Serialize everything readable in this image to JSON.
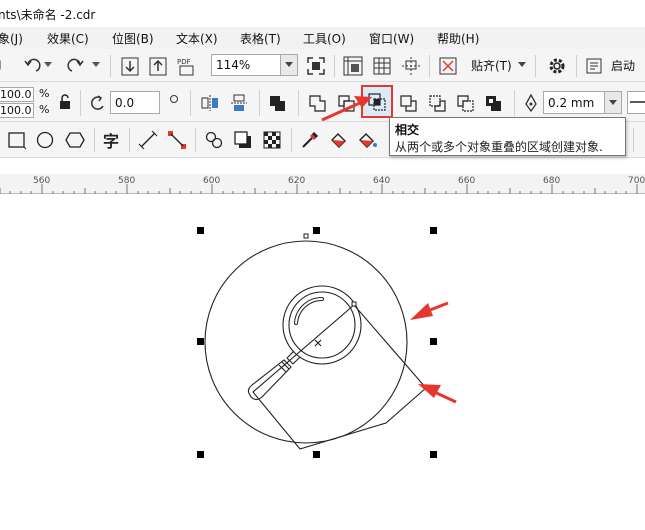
{
  "window": {
    "title": "nts\\未命名 -2.cdr"
  },
  "menubar": {
    "items": [
      "象(J)",
      "效果(C)",
      "位图(B)",
      "文本(X)",
      "表格(T)",
      "工具(O)",
      "窗口(W)",
      "帮助(H)"
    ]
  },
  "standard_toolbar": {
    "zoom_value": "114%",
    "snap_label": "贴齐(T)",
    "launch_label": "启动",
    "icons": [
      "import-icon",
      "export-icon",
      "publish-pdf-icon",
      "full-screen-icon",
      "ruler-toggle-icon",
      "grid-toggle-icon",
      "guidelines-icon",
      "snap-off-icon",
      "settings-gear-icon",
      "launch-icon",
      "undo-icon",
      "redo-icon"
    ]
  },
  "property_bar": {
    "scale_x": "100.0",
    "scale_y": "100.0",
    "percent_sign": "%",
    "rotation": "0.0",
    "outline_width": "0.2 mm",
    "shaping_tools": [
      "weld",
      "trim",
      "intersect",
      "simplify",
      "front-minus-back",
      "back-minus-front",
      "create-boundary"
    ]
  },
  "tooltip": {
    "title": "相交",
    "description": "从两个或多个对象重叠的区域创建对象."
  },
  "tools_toolbar": {
    "text_tool_glyph": "字"
  },
  "ruler": {
    "labels": [
      "560",
      "580",
      "600",
      "620",
      "640",
      "660",
      "680",
      "700"
    ]
  },
  "colors": {
    "highlight_border": "#e4372f",
    "arrow_color": "#e4372f",
    "menubar_bg": "#f2f2f2",
    "toolbar_bg": "#f5f5f5"
  }
}
